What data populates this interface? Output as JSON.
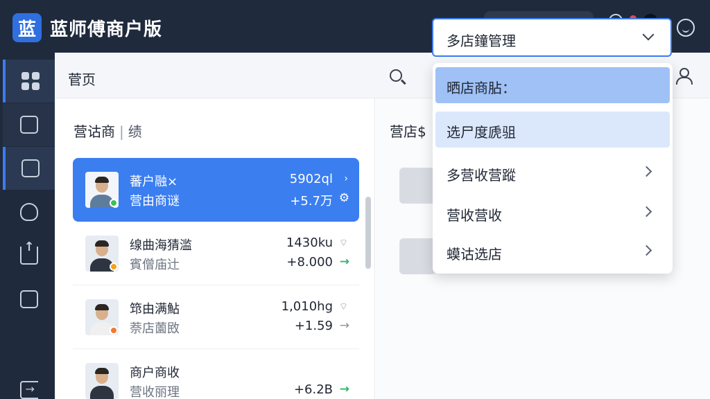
{
  "app": {
    "logo_char": "蓝",
    "title": "蓝师傅商户版"
  },
  "header": {
    "page_title": "菅页"
  },
  "left_panel": {
    "heading": "营诂商",
    "heading_sep": "|",
    "heading_suffix": "绩"
  },
  "merchants": [
    {
      "name": "蕃户融×",
      "sub": "营由商谜",
      "value1": "5902ql",
      "value2": "+5.7万",
      "icon1": "›",
      "icon2": "⚙"
    },
    {
      "name": "缐曲海猜滥",
      "sub": "賓僧庙辻",
      "value1": "1430ku",
      "value2": "+8.000",
      "icon1": "⌔",
      "icon2": "→"
    },
    {
      "name": "筇由满鮎",
      "sub": "萘店薗敃",
      "value1": "1,010hg",
      "value2": "+1.59",
      "icon1": "⌔",
      "icon2": "→"
    },
    {
      "name": "商户商收",
      "sub": "营收丽理",
      "value1": "",
      "value2": "+6.2B",
      "icon1": "",
      "icon2": "→"
    }
  ],
  "right_panel": {
    "heading": "营店$"
  },
  "dropdown": {
    "selected": "多店鐘管理",
    "items": [
      {
        "label": "晒店商胋："
      },
      {
        "label": "选⼫度虒驵"
      },
      {
        "label": "多营收营蹤"
      },
      {
        "label": "营收营收"
      },
      {
        "label": "蟆诂选店"
      }
    ]
  },
  "colors": {
    "topbar": "#1f2a3c",
    "accent": "#3a7ef0",
    "highlight": "#9fc1f5",
    "highlight_soft": "#dbe7fb",
    "positive": "#2fb46a"
  }
}
